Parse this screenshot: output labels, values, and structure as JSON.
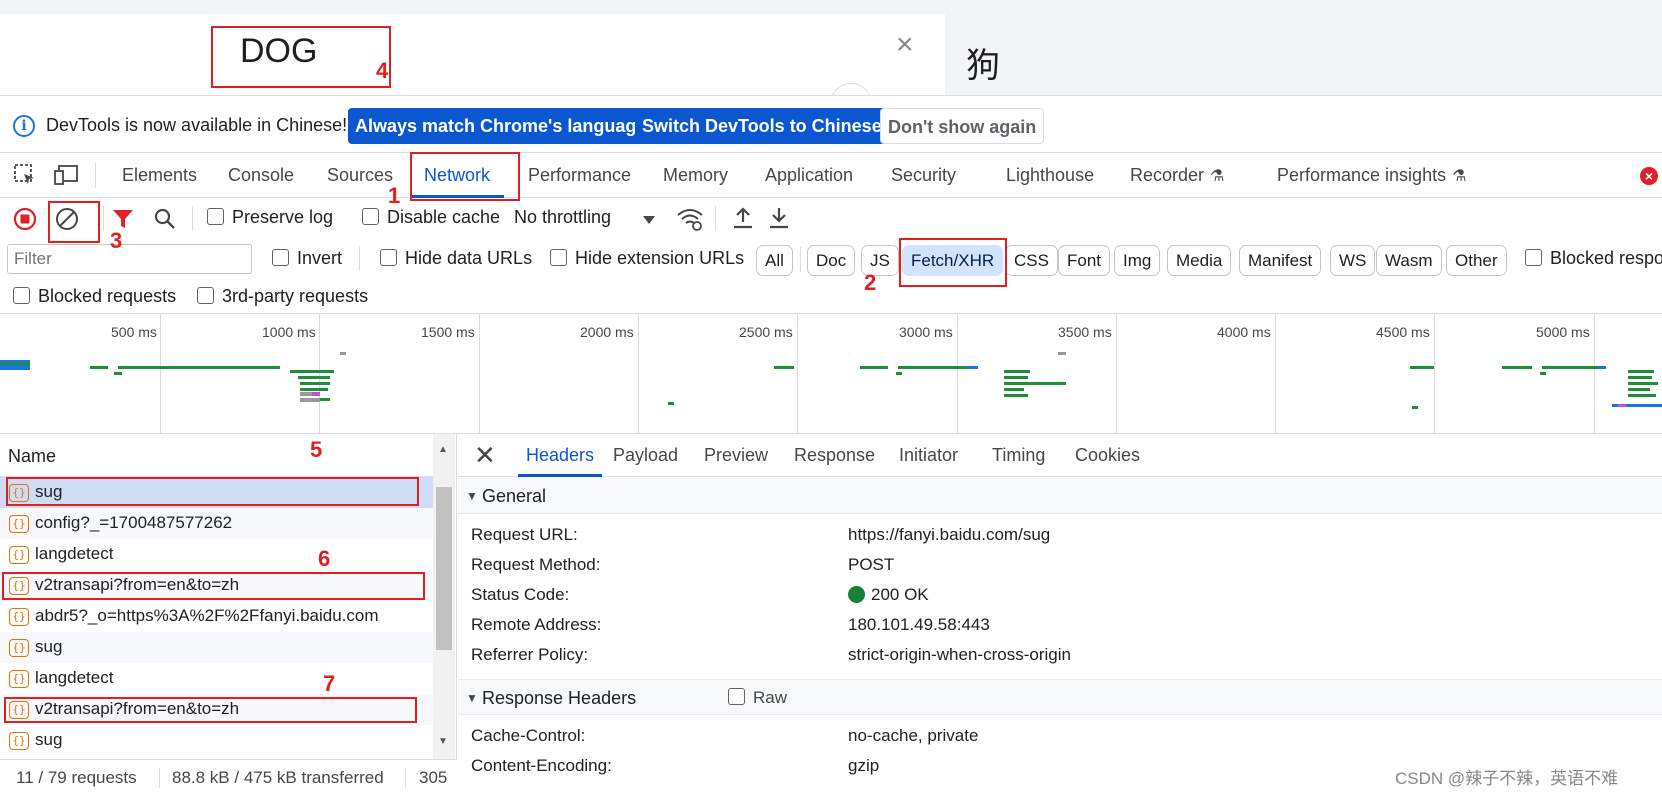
{
  "page": {
    "source_text": "DOG",
    "clear_symbol": "×",
    "target_text": "狗"
  },
  "infobar": {
    "message": "DevTools is now available in Chinese!",
    "btn_match": "Always match Chrome's language",
    "btn_switch": "Switch DevTools to Chinese",
    "btn_dismiss": "Don't show again"
  },
  "tabs": [
    "Elements",
    "Console",
    "Sources",
    "Network",
    "Performance",
    "Memory",
    "Application",
    "Security",
    "Lighthouse",
    "Recorder",
    "Performance insights"
  ],
  "active_tab": "Network",
  "toolbar": {
    "preserve_log": "Preserve log",
    "disable_cache": "Disable cache",
    "throttling": "No throttling"
  },
  "filter": {
    "placeholder": "Filter",
    "invert": "Invert",
    "hide_data_urls": "Hide data URLs",
    "hide_extension_urls": "Hide extension URLs",
    "chips": [
      "All",
      "Doc",
      "JS",
      "Fetch/XHR",
      "CSS",
      "Font",
      "Img",
      "Media",
      "Manifest",
      "WS",
      "Wasm",
      "Other"
    ],
    "active_chip": "Fetch/XHR",
    "blocked_response": "Blocked respo",
    "blocked_requests": "Blocked requests",
    "third_party": "3rd-party requests"
  },
  "overview": {
    "ticks": [
      "500 ms",
      "1000 ms",
      "1500 ms",
      "2000 ms",
      "2500 ms",
      "3000 ms",
      "3500 ms",
      "4000 ms",
      "4500 ms",
      "5000 ms"
    ]
  },
  "requests": {
    "header": "Name",
    "items": [
      "sug",
      "config?_=1700487577262",
      "langdetect",
      "v2transapi?from=en&to=zh",
      "abdr5?_o=https%3A%2F%2Ffanyi.baidu.com",
      "sug",
      "langdetect",
      "v2transapi?from=en&to=zh",
      "sug"
    ],
    "icon_glyph": "{}",
    "status_count": "11 / 79 requests",
    "status_transfer": "88.8 kB / 475 kB transferred",
    "status_extra": "305"
  },
  "details": {
    "tabs": [
      "Headers",
      "Payload",
      "Preview",
      "Response",
      "Initiator",
      "Timing",
      "Cookies"
    ],
    "active_tab": "Headers",
    "general_title": "General",
    "general": [
      {
        "key": "Request URL:",
        "value": "https://fanyi.baidu.com/sug"
      },
      {
        "key": "Request Method:",
        "value": "POST"
      },
      {
        "key": "Status Code:",
        "value": "200 OK"
      },
      {
        "key": "Remote Address:",
        "value": "180.101.49.58:443"
      },
      {
        "key": "Referrer Policy:",
        "value": "strict-origin-when-cross-origin"
      }
    ],
    "response_title": "Response Headers",
    "raw_label": "Raw",
    "response": [
      {
        "key": "Cache-Control:",
        "value": "no-cache, private"
      },
      {
        "key": "Content-Encoding:",
        "value": "gzip"
      }
    ]
  },
  "annotations": [
    "1",
    "2",
    "3",
    "4",
    "5",
    "6",
    "7"
  ],
  "watermark": "CSDN @辣子不辣，英语不难",
  "colors": {
    "accent": "#0b57d0",
    "annotation_red": "#e02020",
    "xhr_orange": "#e37400",
    "status_green": "#188038",
    "record_red": "#e0202b"
  }
}
